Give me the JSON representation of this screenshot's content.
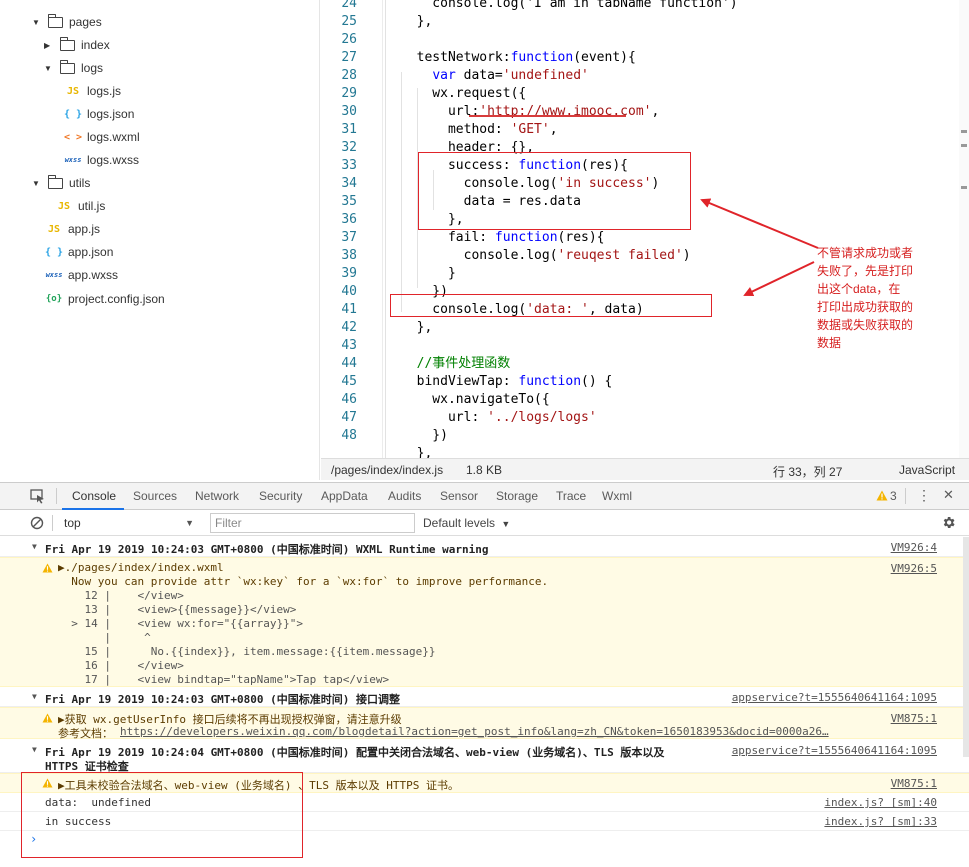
{
  "file_tree": [
    {
      "label": "pages",
      "type": "folder",
      "expanded": true,
      "depth": 0
    },
    {
      "label": "index",
      "type": "folder",
      "expanded": false,
      "depth": 1
    },
    {
      "label": "logs",
      "type": "folder",
      "expanded": true,
      "depth": 1
    },
    {
      "label": "logs.js",
      "type": "js",
      "badge": "JS",
      "depth": 2
    },
    {
      "label": "logs.json",
      "type": "json",
      "badge": "{ }",
      "depth": 2
    },
    {
      "label": "logs.wxml",
      "type": "wxml",
      "badge": "< >",
      "depth": 2
    },
    {
      "label": "logs.wxss",
      "type": "wxss",
      "badge": "wxss",
      "depth": 2
    },
    {
      "label": "utils",
      "type": "folder",
      "expanded": true,
      "depth": 0
    },
    {
      "label": "util.js",
      "type": "js",
      "badge": "JS",
      "depth": 1
    },
    {
      "label": "app.js",
      "type": "js",
      "badge": "JS",
      "depth": 0
    },
    {
      "label": "app.json",
      "type": "json",
      "badge": "{ }",
      "depth": 0
    },
    {
      "label": "app.wxss",
      "type": "wxss",
      "badge": "wxss",
      "depth": 0
    },
    {
      "label": "project.config.json",
      "type": "config",
      "badge": "{o}",
      "depth": 0
    }
  ],
  "editor": {
    "line_numbers": [
      "24",
      "25",
      "26",
      "27",
      "28",
      "29",
      "30",
      "31",
      "32",
      "33",
      "34",
      "35",
      "36",
      "37",
      "38",
      "39",
      "40",
      "41",
      "42",
      "43",
      "44",
      "45",
      "46",
      "47",
      "48"
    ],
    "lines": [
      [
        [
          "    console.log('I am in tabName function')",
          "n"
        ]
      ],
      [
        [
          "  },",
          "n"
        ]
      ],
      [
        [
          "",
          "n"
        ]
      ],
      [
        [
          "  testNetwork:",
          "n"
        ],
        [
          "function",
          "kw"
        ],
        [
          "(event){",
          "n"
        ]
      ],
      [
        [
          "    ",
          "n"
        ],
        [
          "var",
          "kw"
        ],
        [
          " data=",
          "n"
        ],
        [
          "'undefined'",
          "str"
        ]
      ],
      [
        [
          "    wx.request({",
          "n"
        ]
      ],
      [
        [
          "      url:",
          "n"
        ],
        [
          "'http://www.imooc.com'",
          "str"
        ],
        [
          ",",
          "n"
        ]
      ],
      [
        [
          "      method: ",
          "n"
        ],
        [
          "'GET'",
          "str"
        ],
        [
          ",",
          "n"
        ]
      ],
      [
        [
          "      header: {},",
          "n"
        ]
      ],
      [
        [
          "      success: ",
          "n"
        ],
        [
          "function",
          "kw"
        ],
        [
          "(res){",
          "n"
        ]
      ],
      [
        [
          "        console.log(",
          "n"
        ],
        [
          "'in success'",
          "str"
        ],
        [
          ")",
          "n"
        ]
      ],
      [
        [
          "        data = res.data",
          "n"
        ]
      ],
      [
        [
          "      },",
          "n"
        ]
      ],
      [
        [
          "      fail: ",
          "n"
        ],
        [
          "function",
          "kw"
        ],
        [
          "(res){",
          "n"
        ]
      ],
      [
        [
          "        console.log(",
          "n"
        ],
        [
          "'reuqest failed'",
          "str"
        ],
        [
          ")",
          "n"
        ]
      ],
      [
        [
          "      }",
          "n"
        ]
      ],
      [
        [
          "    })",
          "n"
        ]
      ],
      [
        [
          "    console.log(",
          "n"
        ],
        [
          "'data: '",
          "str"
        ],
        [
          ", data)",
          "n"
        ]
      ],
      [
        [
          "  },",
          "n"
        ]
      ],
      [
        [
          "",
          "n"
        ]
      ],
      [
        [
          "  ",
          "n"
        ],
        [
          "//事件处理函数",
          "cmt"
        ]
      ],
      [
        [
          "  bindViewTap: ",
          "n"
        ],
        [
          "function",
          "kw"
        ],
        [
          "() {",
          "n"
        ]
      ],
      [
        [
          "    wx.navigateTo({",
          "n"
        ]
      ],
      [
        [
          "      url: ",
          "n"
        ],
        [
          "'../logs/logs'",
          "str"
        ]
      ],
      [
        [
          "    })",
          "n"
        ]
      ],
      [
        [
          "  },",
          "n"
        ]
      ]
    ]
  },
  "status_bar": {
    "path": "/pages/index/index.js",
    "size": "1.8 KB",
    "position": "行 33，列 27",
    "language": "JavaScript"
  },
  "annotation": {
    "lines": [
      "不管请求成功或者",
      "失败了，先是打印",
      "出这个data，在",
      "打印出成功获取的",
      "数据或失败获取的",
      "数据"
    ]
  },
  "devtools": {
    "tabs": [
      "Console",
      "Sources",
      "Network",
      "Security",
      "AppData",
      "Audits",
      "Sensor",
      "Storage",
      "Trace",
      "Wxml"
    ],
    "active_tab": "Console",
    "warning_count": "3"
  },
  "console_toolbar": {
    "context": "top",
    "filter_placeholder": "Filter",
    "levels": "Default levels"
  },
  "console": {
    "group1": {
      "title": "Fri Apr 19 2019 10:24:03 GMT+0800 (中国标准时间) WXML Runtime warning",
      "source": "VM926:4",
      "warn_source": "VM926:5",
      "warn_lines": [
        "▶./pages/index/index.wxml",
        "  Now you can provide attr `wx:key` for a `wx:for` to improve performance.",
        "    12 |    </view>",
        "    13 |    <view>{{message}}</view>",
        "  > 14 |    <view wx:for=\"{{array}}\">",
        "       |     ^",
        "    15 |      No.{{index}}, item.message:{{item.message}}",
        "    16 |    </view>",
        "    17 |    <view bindtap=\"tapName\">Tap tap</view>"
      ]
    },
    "group2": {
      "title": "Fri Apr 19 2019 10:24:03 GMT+0800 (中国标准时间) 接口调整",
      "source": "appservice?t=1555640641164:1095",
      "warn_line1": "▶获取 wx.getUserInfo 接口后续将不再出现授权弹窗，请注意升级",
      "warn_label": "参考文档：",
      "warn_link": "https://developers.weixin.qq.com/blogdetail?action=get_post_info&lang=zh_CN&token=1650183953&docid=0000a26…",
      "warn_source": "VM875:1"
    },
    "group3": {
      "title_line1": "Fri Apr 19 2019 10:24:04 GMT+0800 (中国标准时间) 配置中关闭合法域名、web-view (业务域名)、TLS 版本以及",
      "title_line2": "HTTPS 证书检查",
      "source": "appservice?t=1555640641164:1095",
      "warn_line": "▶工具未校验合法域名、web-view (业务域名) 、TLS 版本以及 HTTPS 证书。",
      "warn_source": "VM875:1"
    },
    "log1": {
      "text": "data:  undefined",
      "source": "index.js? [sm]:40"
    },
    "log2": {
      "text": "in success",
      "source": "index.js? [sm]:33"
    },
    "prompt": "›"
  }
}
